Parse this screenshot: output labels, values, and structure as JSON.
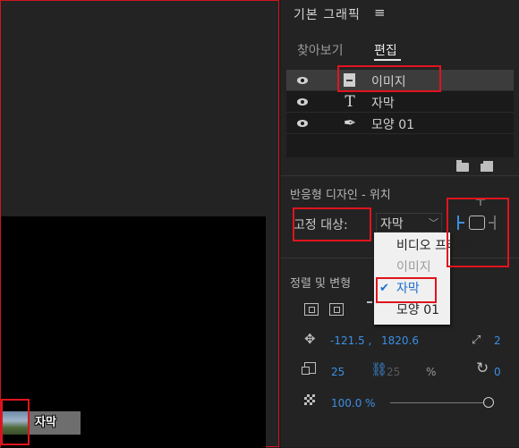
{
  "monitor": {
    "clip_label": "자막"
  },
  "panel": {
    "title": "기본 그래픽",
    "menu_icon": "≡",
    "tabs": [
      {
        "label": "찾아보기",
        "active": false
      },
      {
        "label": "편집",
        "active": true
      }
    ],
    "layers": [
      {
        "label": "이미지",
        "icon": "image-icon",
        "selected": true
      },
      {
        "label": "자막",
        "icon": "text-icon",
        "selected": false
      },
      {
        "label": "모양 01",
        "icon": "pen-icon",
        "selected": false
      }
    ],
    "responsive_design": {
      "title": "반응형 디자인 - 위치",
      "pin_label": "고정 대상:",
      "pin_value": "자막"
    },
    "align": {
      "title": "정렬 및 변형",
      "position_x": "-121.5 ,",
      "position_y": "1820.6",
      "anchor": "2",
      "scale": "25",
      "scale_height": "25",
      "scale_unit": "%",
      "rotation": "0",
      "opacity": "100.0",
      "opacity_unit": "%",
      "opacity_level": 1.0
    }
  },
  "dropdown": {
    "items": [
      {
        "label": "비디오 프레임",
        "state": "normal"
      },
      {
        "label": "이미지",
        "state": "disabled"
      },
      {
        "label": "자막",
        "state": "checked"
      },
      {
        "label": "모양 01",
        "state": "normal"
      }
    ]
  },
  "colors": {
    "accent_blue": "#3b8fe3",
    "highlight_red": "#e0141e",
    "panel_bg": "#232323"
  }
}
